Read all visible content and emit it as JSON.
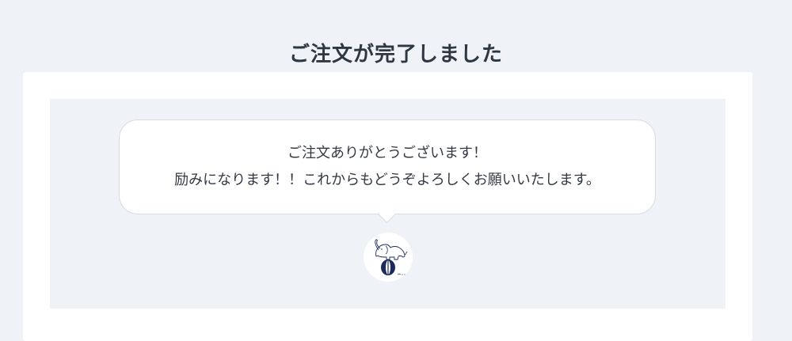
{
  "page": {
    "title": "ご注文が完了しました"
  },
  "message": {
    "line1": "ご注文ありがとうございます！",
    "line2": "励みになります！！これからもどうぞよろしくお願いいたします。"
  },
  "seller": {
    "avatar_icon": "elephant-on-ball-icon"
  },
  "colors": {
    "background": "#eff3f7",
    "card": "#ffffff",
    "bubble_border": "#d5dbe3",
    "avatar_ink": "#1a2a5c"
  }
}
